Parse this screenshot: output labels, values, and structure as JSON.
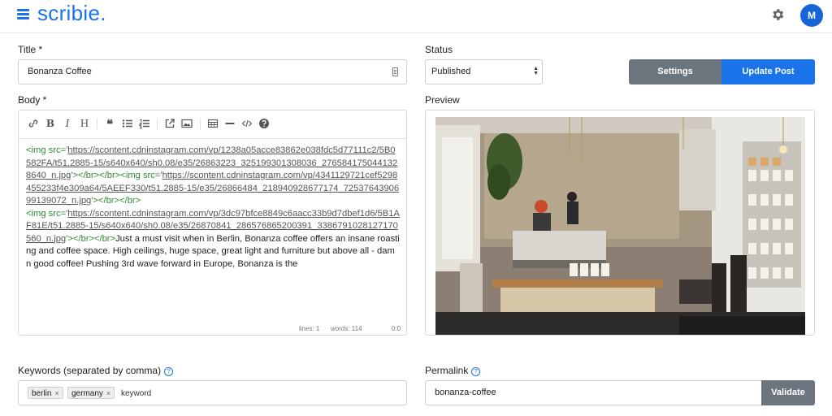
{
  "app": {
    "brand": "scribie.",
    "avatar_initial": "M"
  },
  "form": {
    "title_label": "Title *",
    "title_value": "Bonanza Coffee",
    "status_label": "Status",
    "status_value": "Published",
    "settings_button": "Settings",
    "update_button": "Update Post",
    "body_label": "Body *",
    "preview_label": "Preview",
    "keywords_label": "Keywords (separated by comma)",
    "keywords": [
      {
        "label": "berlin"
      },
      {
        "label": "germany"
      }
    ],
    "keyword_placeholder": "keyword",
    "permalink_label": "Permalink",
    "permalink_value": "bonanza-coffee",
    "validate_button": "Validate"
  },
  "editor": {
    "toolbar": [
      "link-icon",
      "bold-icon",
      "italic-icon",
      "heading-icon",
      "quote-icon",
      "bullet-list-icon",
      "numbered-list-icon",
      "external-link-icon",
      "image-icon",
      "table-icon",
      "horizontal-rule-icon",
      "code-icon",
      "help-icon"
    ],
    "content": {
      "img1_open": "<img src='",
      "img1_url": "https://scontent.cdninstagram.com/vp/1238a05acce83862e038fdc5d77111c2/5B0582FA/t51.2885-15/s640x640/sh0.08/e35/26863223_325199301308036_2765841750441328640_n.jpg",
      "img1_close": "'></br></br>",
      "img2_open": "<img src='",
      "img2_url": "https://scontent.cdninstagram.com/vp/4341129721cef5298455233f4e309a64/5AEEF330/t51.2885-15/e35/26866484_218940928677174_7253764390699139072_n.jpg",
      "img2_close": "'></br></br>",
      "img3_open": "<img src='",
      "img3_url": "https://scontent.cdninstagram.com/vp/3dc97bfce8849c6aacc33b9d7dbef1d6/5B1AF81E/t51.2885-15/s640x640/sh0.08/e35/26870841_286576865200391_3386791028127170560_n.jpg",
      "img3_close": "'></br></br>",
      "text": "Just a must visit when in Berlin, Bonanza coffee offers an insane roasting and coffee space. High ceilings, huge space, great light and furniture but above all - damn good coffee! Pushing 3rd wave forward in Europe, Bonanza is the"
    },
    "stats": {
      "lines": "lines: 1",
      "words": "words: 114",
      "cursor": "0:0"
    }
  },
  "colors": {
    "accent": "#1a73e8",
    "secondary_button": "#6c757d"
  }
}
